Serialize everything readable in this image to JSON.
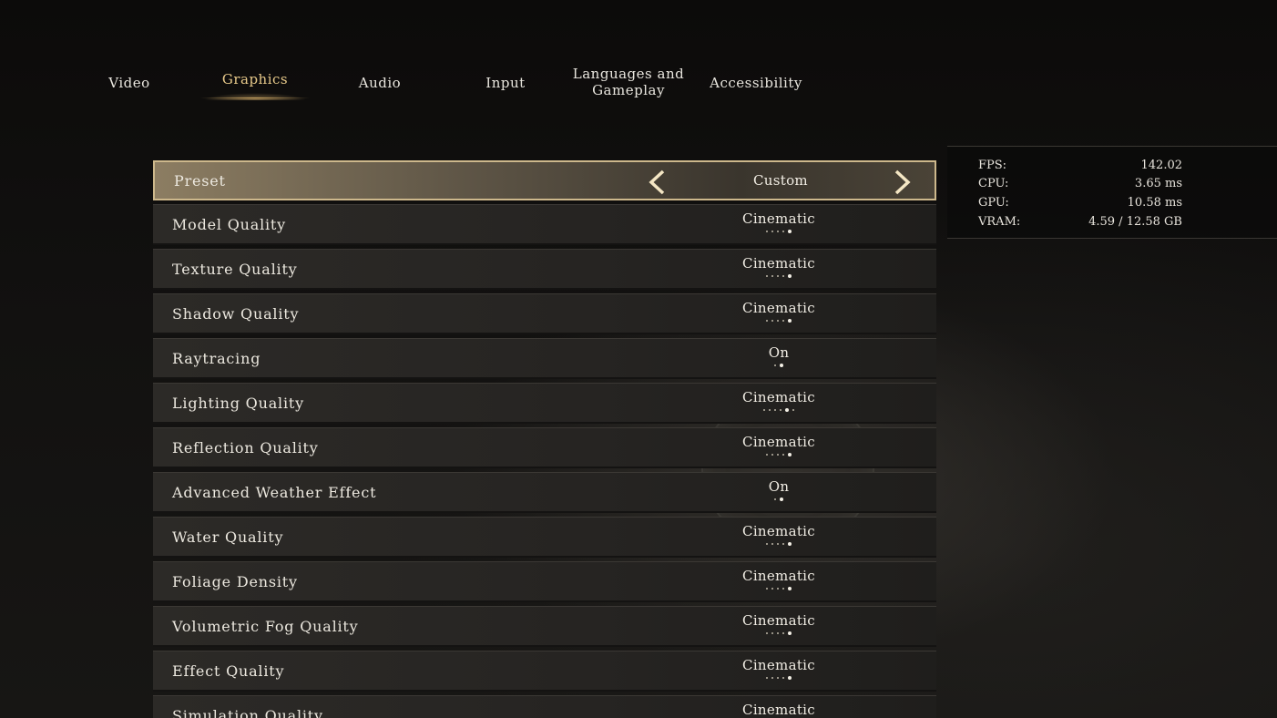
{
  "tabs": [
    {
      "label": "Video"
    },
    {
      "label": "Graphics"
    },
    {
      "label": "Audio"
    },
    {
      "label": "Input"
    },
    {
      "label": "Languages and Gameplay"
    },
    {
      "label": "Accessibility"
    }
  ],
  "active_tab": "Graphics",
  "preset": {
    "label": "Preset",
    "value": "Custom"
  },
  "settings": [
    {
      "label": "Model Quality",
      "value": "Cinematic",
      "level": 5,
      "levels": 5
    },
    {
      "label": "Texture Quality",
      "value": "Cinematic",
      "level": 5,
      "levels": 5
    },
    {
      "label": "Shadow Quality",
      "value": "Cinematic",
      "level": 5,
      "levels": 5
    },
    {
      "label": "Raytracing",
      "value": "On",
      "level": 2,
      "levels": 2
    },
    {
      "label": "Lighting Quality",
      "value": "Cinematic",
      "level": 5,
      "levels": 6
    },
    {
      "label": "Reflection Quality",
      "value": "Cinematic",
      "level": 5,
      "levels": 5
    },
    {
      "label": "Advanced Weather Effect",
      "value": "On",
      "level": 2,
      "levels": 2
    },
    {
      "label": "Water Quality",
      "value": "Cinematic",
      "level": 5,
      "levels": 5
    },
    {
      "label": "Foliage Density",
      "value": "Cinematic",
      "level": 5,
      "levels": 5
    },
    {
      "label": "Volumetric Fog Quality",
      "value": "Cinematic",
      "level": 5,
      "levels": 5
    },
    {
      "label": "Effect Quality",
      "value": "Cinematic",
      "level": 5,
      "levels": 5
    },
    {
      "label": "Simulation Quality",
      "value": "Cinematic",
      "level": 5,
      "levels": 5
    }
  ],
  "perf": {
    "fps": {
      "label": "FPS:",
      "value": "142.02"
    },
    "cpu": {
      "label": "CPU:",
      "value": "3.65  ms"
    },
    "gpu": {
      "label": "GPU:",
      "value": "10.58  ms"
    },
    "vram": {
      "label": "VRAM:",
      "value": "4.59  /  12.58  GB"
    }
  },
  "icons": {
    "prev": "chevron-left-icon",
    "next": "chevron-right-icon"
  },
  "colors": {
    "accent": "#e7c98a",
    "selected_border": "#cdb88c"
  }
}
